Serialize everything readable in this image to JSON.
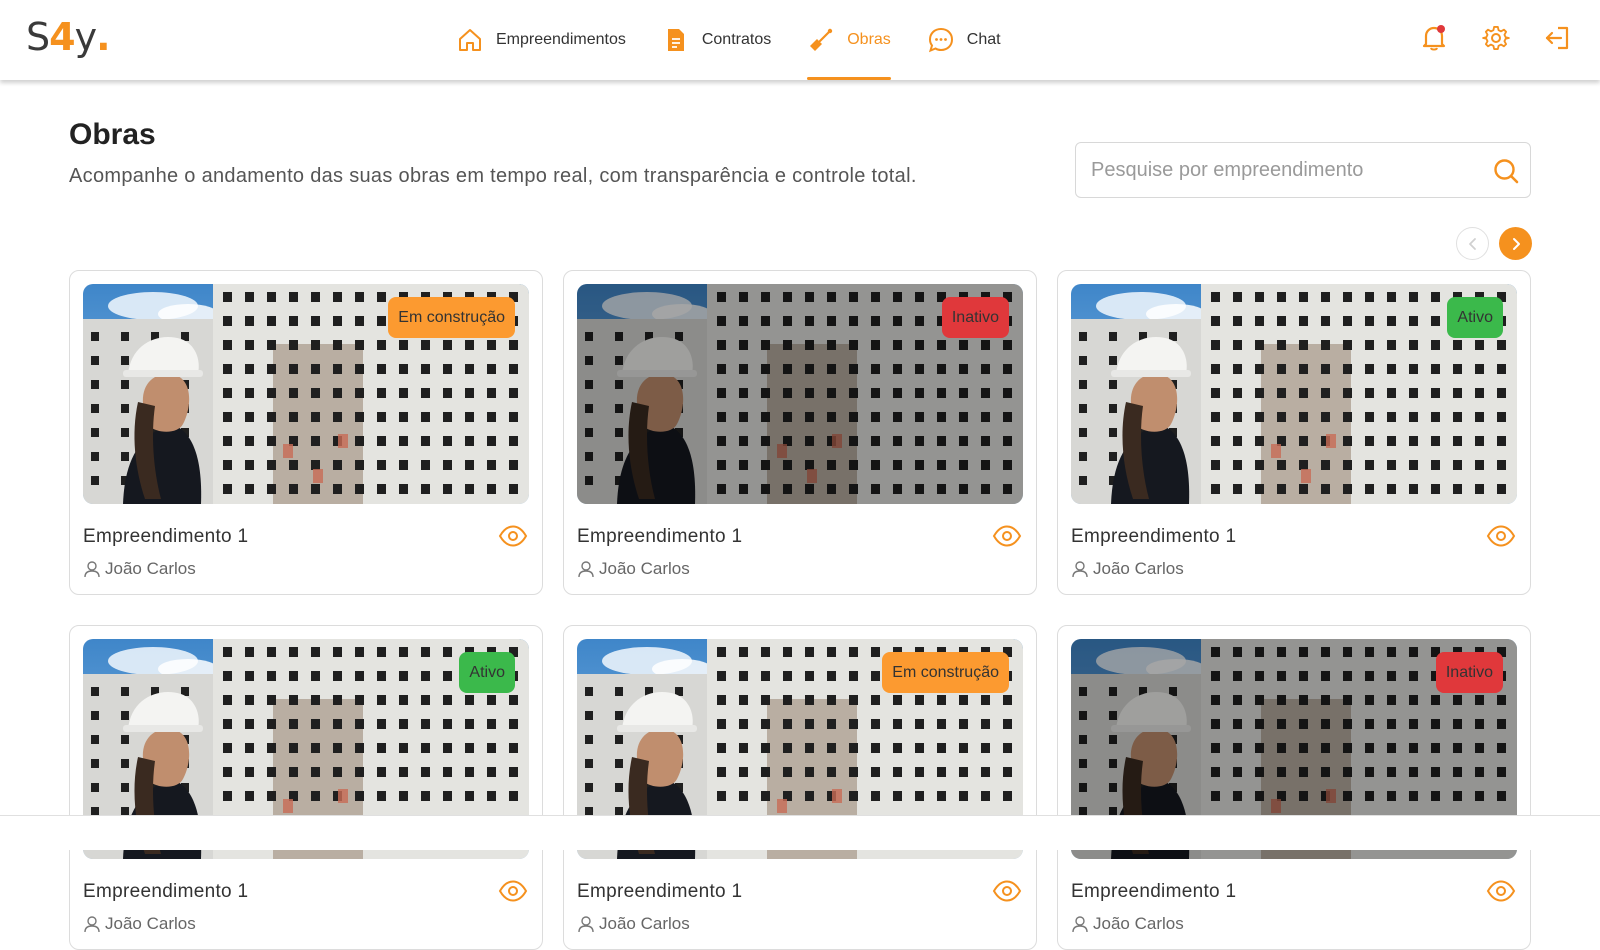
{
  "header": {
    "logo": {
      "s": "S",
      "four": "4",
      "y": "y",
      "dot": "."
    },
    "nav": [
      {
        "label": "Empreendimentos",
        "icon": "home-icon",
        "active": false
      },
      {
        "label": "Contratos",
        "icon": "document-icon",
        "active": false
      },
      {
        "label": "Obras",
        "icon": "trowel-icon",
        "active": true
      },
      {
        "label": "Chat",
        "icon": "chat-icon",
        "active": false
      }
    ],
    "actions": [
      "bell-icon",
      "gear-icon",
      "logout-icon"
    ]
  },
  "page": {
    "title": "Obras",
    "subtitle": "Acompanhe o andamento das suas obras em tempo real, com transparência e controle total.",
    "search_placeholder": "Pesquise por empreendimento"
  },
  "cards": [
    {
      "name": "Empreendimento 1",
      "owner": "João Carlos",
      "status": "Em construção",
      "status_key": "construcao",
      "dimmed": false
    },
    {
      "name": "Empreendimento 1",
      "owner": "João Carlos",
      "status": "Inativo",
      "status_key": "inativo",
      "dimmed": true
    },
    {
      "name": "Empreendimento 1",
      "owner": "João Carlos",
      "status": "Ativo",
      "status_key": "ativo",
      "dimmed": false
    },
    {
      "name": "Empreendimento 1",
      "owner": "João Carlos",
      "status": "Ativo",
      "status_key": "ativo",
      "dimmed": false
    },
    {
      "name": "Empreendimento 1",
      "owner": "João Carlos",
      "status": "Em construção",
      "status_key": "construcao",
      "dimmed": false
    },
    {
      "name": "Empreendimento 1",
      "owner": "João Carlos",
      "status": "Inativo",
      "status_key": "inativo",
      "dimmed": true
    }
  ],
  "colors": {
    "accent": "#f5911e",
    "status_construcao": "#fc9a30",
    "status_inativo": "#e0383b",
    "status_ativo": "#3bb94b"
  }
}
